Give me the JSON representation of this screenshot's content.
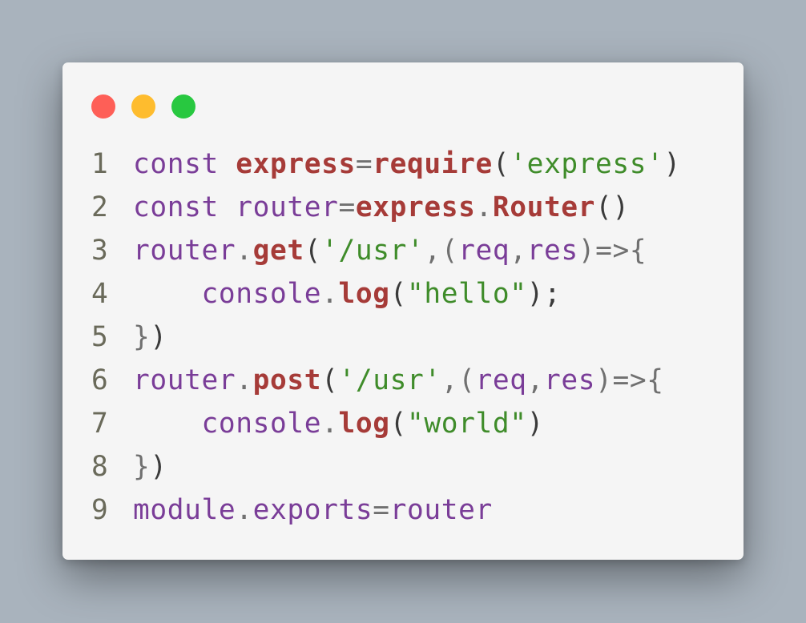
{
  "window": {
    "buttons": [
      {
        "name": "close-button",
        "color": "#fe5f57"
      },
      {
        "name": "minimize-button",
        "color": "#febc2e"
      },
      {
        "name": "maximize-button",
        "color": "#28c840"
      }
    ]
  },
  "code_lines": [
    {
      "number": "1",
      "tokens": [
        {
          "text": "const",
          "type": "kw"
        },
        {
          "text": " ",
          "type": "pn"
        },
        {
          "text": "express",
          "type": "bd"
        },
        {
          "text": "=",
          "type": "p"
        },
        {
          "text": "require",
          "type": "bd"
        },
        {
          "text": "(",
          "type": "pn"
        },
        {
          "text": "'express'",
          "type": "st"
        },
        {
          "text": ")",
          "type": "pn"
        }
      ]
    },
    {
      "number": "2",
      "tokens": [
        {
          "text": "const",
          "type": "kw"
        },
        {
          "text": " ",
          "type": "pn"
        },
        {
          "text": "router",
          "type": "kw"
        },
        {
          "text": "=",
          "type": "p"
        },
        {
          "text": "express",
          "type": "bd"
        },
        {
          "text": ".",
          "type": "p"
        },
        {
          "text": "Router",
          "type": "bd"
        },
        {
          "text": "()",
          "type": "pn"
        }
      ]
    },
    {
      "number": "3",
      "tokens": [
        {
          "text": "router",
          "type": "kw"
        },
        {
          "text": ".",
          "type": "p"
        },
        {
          "text": "get",
          "type": "bd"
        },
        {
          "text": "(",
          "type": "pn"
        },
        {
          "text": "'/usr'",
          "type": "st"
        },
        {
          "text": ",(",
          "type": "p"
        },
        {
          "text": "req",
          "type": "kw"
        },
        {
          "text": ",",
          "type": "p"
        },
        {
          "text": "res",
          "type": "kw"
        },
        {
          "text": ")=>{",
          "type": "p"
        }
      ]
    },
    {
      "number": "4",
      "tokens": [
        {
          "text": "    ",
          "type": "pn"
        },
        {
          "text": "console",
          "type": "kw"
        },
        {
          "text": ".",
          "type": "p"
        },
        {
          "text": "log",
          "type": "bd"
        },
        {
          "text": "(",
          "type": "pn"
        },
        {
          "text": "\"hello\"",
          "type": "st"
        },
        {
          "text": ");",
          "type": "pn"
        }
      ]
    },
    {
      "number": "5",
      "tokens": [
        {
          "text": "}",
          "type": "p"
        },
        {
          "text": ")",
          "type": "pn"
        }
      ]
    },
    {
      "number": "6",
      "tokens": [
        {
          "text": "router",
          "type": "kw"
        },
        {
          "text": ".",
          "type": "p"
        },
        {
          "text": "post",
          "type": "bd"
        },
        {
          "text": "(",
          "type": "pn"
        },
        {
          "text": "'/usr'",
          "type": "st"
        },
        {
          "text": ",(",
          "type": "p"
        },
        {
          "text": "req",
          "type": "kw"
        },
        {
          "text": ",",
          "type": "p"
        },
        {
          "text": "res",
          "type": "kw"
        },
        {
          "text": ")=>{",
          "type": "p"
        }
      ]
    },
    {
      "number": "7",
      "tokens": [
        {
          "text": "    ",
          "type": "pn"
        },
        {
          "text": "console",
          "type": "kw"
        },
        {
          "text": ".",
          "type": "p"
        },
        {
          "text": "log",
          "type": "bd"
        },
        {
          "text": "(",
          "type": "pn"
        },
        {
          "text": "\"world\"",
          "type": "st"
        },
        {
          "text": ")",
          "type": "pn"
        }
      ]
    },
    {
      "number": "8",
      "tokens": [
        {
          "text": "}",
          "type": "p"
        },
        {
          "text": ")",
          "type": "pn"
        }
      ]
    },
    {
      "number": "9",
      "tokens": [
        {
          "text": "module",
          "type": "kw"
        },
        {
          "text": ".",
          "type": "p"
        },
        {
          "text": "exports",
          "type": "kw"
        },
        {
          "text": "=",
          "type": "p"
        },
        {
          "text": "router",
          "type": "kw"
        }
      ]
    }
  ]
}
